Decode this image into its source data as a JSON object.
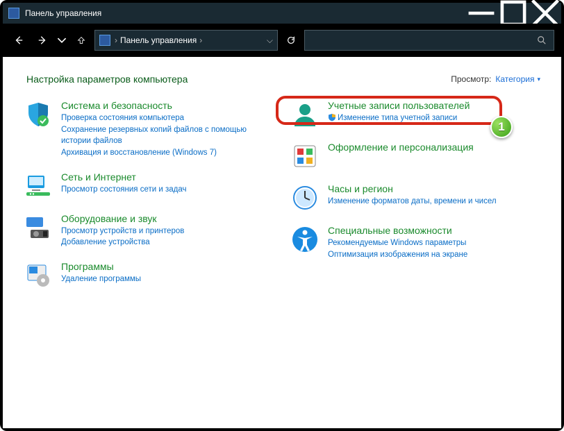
{
  "window": {
    "title": "Панель управления"
  },
  "breadcrumb": {
    "root": "Панель управления"
  },
  "header": {
    "title": "Настройка параметров компьютера",
    "viewby_label": "Просмотр:",
    "viewby_value": "Категория"
  },
  "left": [
    {
      "title": "Система и безопасность",
      "subs": [
        "Проверка состояния компьютера",
        "Сохранение резервных копий файлов с помощью истории файлов",
        "Архивация и восстановление (Windows 7)"
      ]
    },
    {
      "title": "Сеть и Интернет",
      "subs": [
        "Просмотр состояния сети и задач"
      ]
    },
    {
      "title": "Оборудование и звук",
      "subs": [
        "Просмотр устройств и принтеров",
        "Добавление устройства"
      ]
    },
    {
      "title": "Программы",
      "subs": [
        "Удаление программы"
      ]
    }
  ],
  "right": [
    {
      "title": "Учетные записи пользователей",
      "subs": [
        {
          "text": "Изменение типа учетной записи",
          "shield": true
        }
      ]
    },
    {
      "title": "Оформление и персонализация",
      "subs": []
    },
    {
      "title": "Часы и регион",
      "subs": [
        "Изменение форматов даты, времени и чисел"
      ]
    },
    {
      "title": "Специальные возможности",
      "subs": [
        "Рекомендуемые Windows параметры",
        "Оптимизация изображения на экране"
      ]
    }
  ],
  "callout": {
    "step": "1"
  }
}
